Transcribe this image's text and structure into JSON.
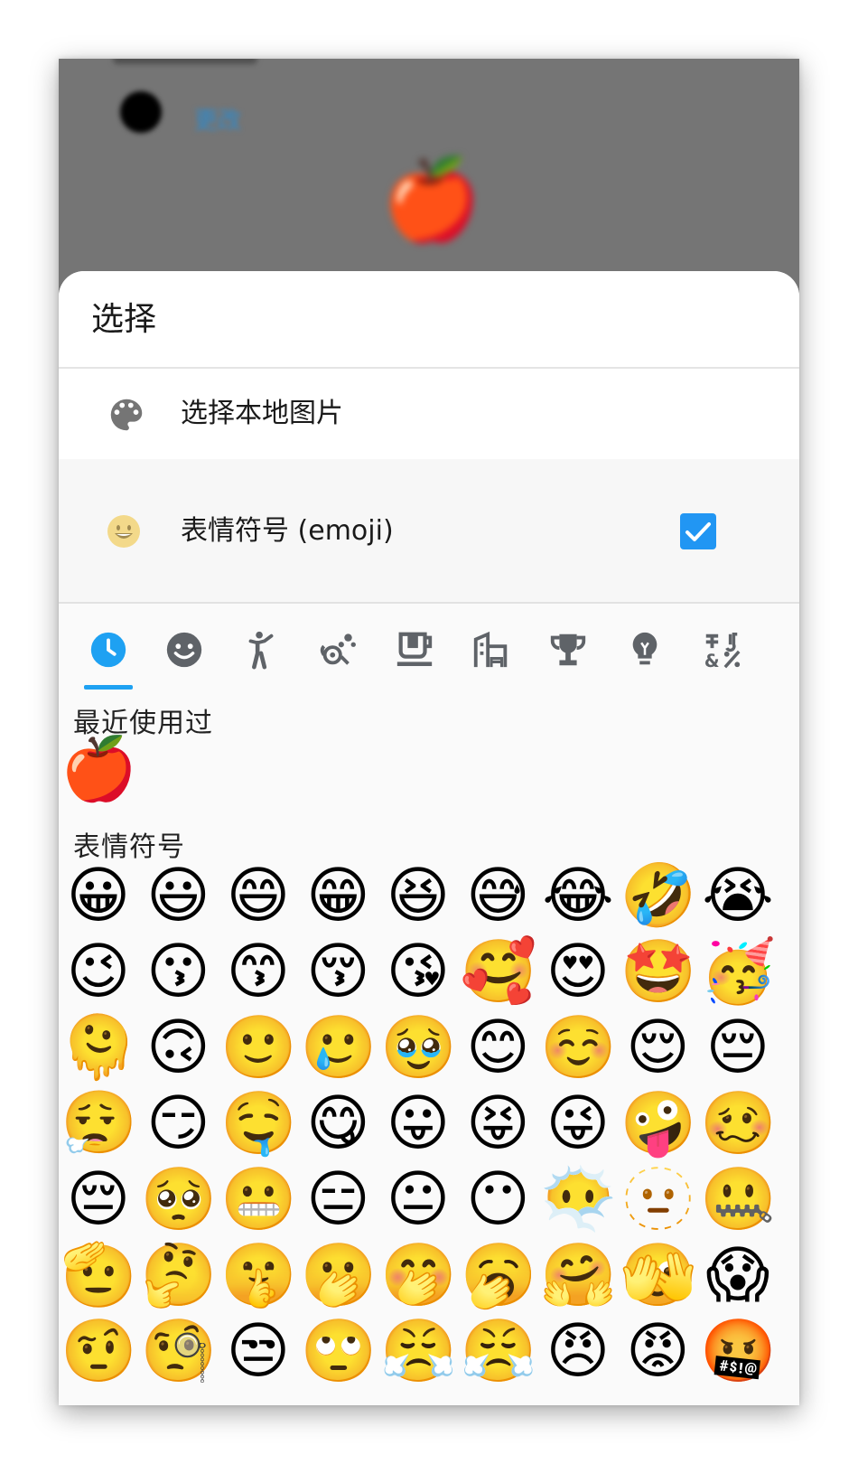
{
  "background": {
    "link_text": "更改",
    "apple": "🍎"
  },
  "sheet": {
    "title": "选择",
    "options": [
      {
        "label": "选择本地图片",
        "icon": "palette-icon"
      },
      {
        "label": "表情符号 (emoji)",
        "icon": "smiley-icon",
        "checked": true
      }
    ]
  },
  "tabs": [
    {
      "icon": "clock-icon",
      "selected": true
    },
    {
      "icon": "smiley-face-icon"
    },
    {
      "icon": "person-icon"
    },
    {
      "icon": "nature-icon"
    },
    {
      "icon": "food-cup-icon"
    },
    {
      "icon": "building-icon"
    },
    {
      "icon": "trophy-icon"
    },
    {
      "icon": "lightbulb-icon"
    },
    {
      "icon": "symbols-icon"
    }
  ],
  "sections": {
    "recent": {
      "title": "最近使用过",
      "items": [
        "🍎"
      ]
    },
    "smileys": {
      "title": "表情符号",
      "items": [
        "😀",
        "😃",
        "😄",
        "😁",
        "😆",
        "😅",
        "😂",
        "🤣",
        "😭",
        "😉",
        "😗",
        "😙",
        "😚",
        "😘",
        "🥰",
        "😍",
        "🤩",
        "🥳",
        "🫠",
        "🙃",
        "🙂",
        "🥲",
        "🥹",
        "😊",
        "☺️",
        "😌",
        "😔",
        "😮‍💨",
        "😏",
        "🤤",
        "😋",
        "😛",
        "😝",
        "😜",
        "🤪",
        "🥴",
        "😔",
        "🥺",
        "😬",
        "😑",
        "😐",
        "😶",
        "😶‍🌫️",
        "🫥",
        "🤐",
        "🫡",
        "🤔",
        "🤫",
        "🫢",
        "🤭",
        "🥱",
        "🤗",
        "🫣",
        "😱",
        "🤨",
        "🧐",
        "😒",
        "🙄",
        "😤",
        "😤",
        "😠",
        "😡",
        "🤬"
      ]
    }
  },
  "colors": {
    "accent": "#2196f3",
    "tab_icon": "#5f6368",
    "backdrop": "#757575"
  }
}
